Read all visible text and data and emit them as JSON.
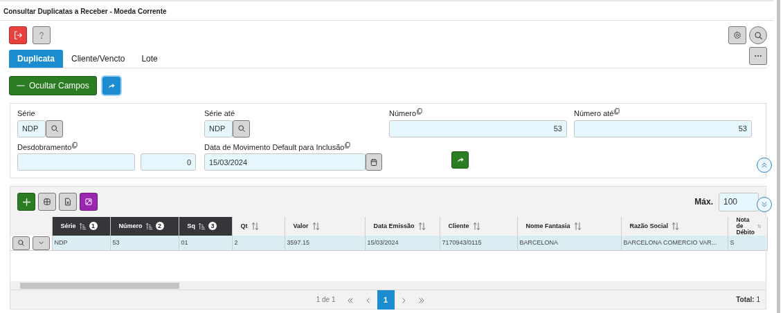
{
  "window": {
    "title": "Consultar Duplicatas a Receber - Moeda Corrente"
  },
  "tabs": [
    {
      "label": "Duplicata",
      "selected": true
    },
    {
      "label": "Cliente/Vencto",
      "selected": false
    },
    {
      "label": "Lote",
      "selected": false
    }
  ],
  "toggle_button": {
    "label": "Ocultar Campos"
  },
  "filters": [
    {
      "kind": "lookup",
      "label": "Série",
      "has_copy_icon": false,
      "value": "NDP"
    },
    {
      "kind": "lookup",
      "label": "Série até",
      "has_copy_icon": false,
      "value": "NDP"
    },
    {
      "kind": "number",
      "label": "Número",
      "has_copy_icon": true,
      "value": "53"
    },
    {
      "kind": "number",
      "label": "Número até",
      "has_copy_icon": true,
      "value": "53"
    },
    {
      "kind": "split",
      "label": "Desdobramento",
      "has_copy_icon": true,
      "value_2": "0"
    },
    {
      "kind": "date",
      "label": "Data de Movimento Default para Inclusão",
      "has_copy_icon": true,
      "value": "15/03/2024"
    },
    {
      "kind": "go"
    }
  ],
  "grid": {
    "max_label": "Máx.",
    "max_value": "100",
    "columns": [
      {
        "label": "Série",
        "sorted": true,
        "sort_order": "1"
      },
      {
        "label": "Número",
        "sorted": true,
        "sort_order": "2"
      },
      {
        "label": "Sq",
        "sorted": true,
        "sort_order": "3"
      },
      {
        "label": "Qt",
        "sorted": false
      },
      {
        "label": "Valor",
        "sorted": false
      },
      {
        "label": "Data Emissão",
        "sorted": false
      },
      {
        "label": "Cliente",
        "sorted": false
      },
      {
        "label": "Nome Fantasia",
        "sorted": false
      },
      {
        "label": "Razão Social",
        "sorted": false
      },
      {
        "label": "Nota de Débito",
        "sorted": false
      }
    ],
    "rows": [
      {
        "selected": true,
        "cells": [
          "NDP",
          "53",
          "01",
          "2",
          "3597.15",
          "15/03/2024",
          "7170943/0115",
          "BARCELONA",
          "BARCELONA COMERCIO VAR...",
          "S"
        ]
      }
    ]
  },
  "pager": {
    "summary": "1 de 1",
    "pages": [
      {
        "label": "1",
        "selected": true
      }
    ],
    "total": "**Total:** 1"
  }
}
